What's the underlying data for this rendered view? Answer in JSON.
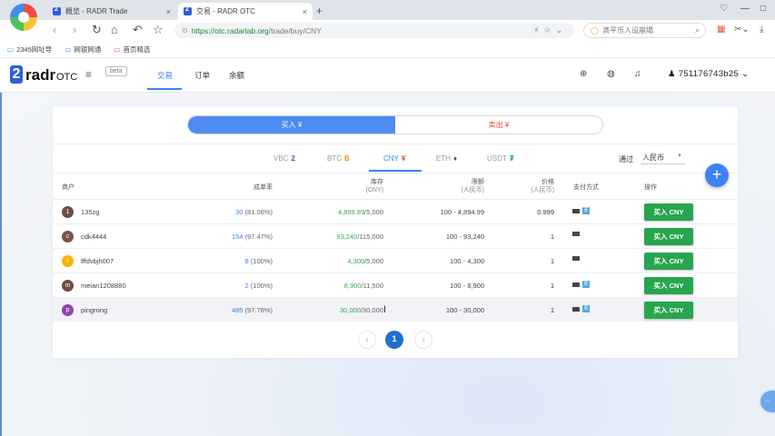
{
  "browser": {
    "tabs": [
      {
        "title": "概览 - RADR Trade",
        "close": "×"
      },
      {
        "title": "交易 - RADR OTC",
        "close": "×"
      }
    ],
    "new_tab": "+",
    "url_host": "https://otc.radarlab.org",
    "url_path": "/trade/buy/CNY",
    "search_placeholder": "滴平乐人设崩塌",
    "bookmarks": [
      "2345网址导",
      "网银网通",
      "首页精选"
    ]
  },
  "app": {
    "logo_mark": "2",
    "logo_text": "radr",
    "logo_sub": "OTC",
    "beta_badge": "beta",
    "nav": [
      "交易",
      "订单",
      "余额"
    ],
    "username": "751176743b25"
  },
  "trade": {
    "toggle": {
      "buy": "买入 ¥",
      "sell": "卖出 ¥"
    },
    "currencies": [
      {
        "code": "VBC",
        "icon": "2"
      },
      {
        "code": "BTC",
        "icon": "B"
      },
      {
        "code": "CNY",
        "icon": "¥"
      },
      {
        "code": "ETH",
        "icon": "♦"
      },
      {
        "code": "USDT",
        "icon": "₮"
      }
    ],
    "via_label": "通过",
    "via_value": "人民币",
    "headers": {
      "merchant": "商户",
      "rate": "成单率",
      "stock": "库存",
      "stock_unit": "(CNY)",
      "limit": "限额",
      "limit_unit": "(人民币)",
      "price": "价格",
      "price_unit": "(人民币)",
      "payment": "支付方式",
      "action": "操作"
    },
    "rows": [
      {
        "initial": "1",
        "avatar_color": "#6d4c41",
        "name": "135zg",
        "rate_n": "30",
        "rate_p": "(81.08%)",
        "stock_avail": "4,899.89",
        "stock_total": "/5,000",
        "limit": "100 - 4,894.99",
        "price": "0.999",
        "alipay": true,
        "btn": "买入 CNY"
      },
      {
        "initial": "c",
        "avatar_color": "#795548",
        "name": "cdk4444",
        "rate_n": "154",
        "rate_p": "(97.47%)",
        "stock_avail": "93,240",
        "stock_total": "/115,000",
        "limit": "100 - 93,240",
        "price": "1",
        "alipay": false,
        "btn": "买入 CNY"
      },
      {
        "initial": "l",
        "avatar_color": "#f5b400",
        "name": "lffdvbjh007",
        "rate_n": "8",
        "rate_p": "(100%)",
        "stock_avail": "4,300",
        "stock_total": "/5,000",
        "limit": "100 - 4,300",
        "price": "1",
        "alipay": false,
        "btn": "买入 CNY"
      },
      {
        "initial": "m",
        "avatar_color": "#6d4c41",
        "name": "meian1208880",
        "rate_n": "2",
        "rate_p": "(100%)",
        "stock_avail": "8,900",
        "stock_total": "/11,500",
        "limit": "100 - 8,900",
        "price": "1",
        "alipay": true,
        "btn": "买入 CNY"
      },
      {
        "initial": "p",
        "avatar_color": "#8e44ad",
        "name": "pingrong",
        "rate_n": "485",
        "rate_p": "(97.78%)",
        "stock_avail": "30,000",
        "stock_total": "/30,000",
        "limit": "100 - 30,000",
        "price": "1",
        "alipay": true,
        "btn": "买入 CNY"
      }
    ],
    "pagination": {
      "prev": "‹",
      "current": "1",
      "next": "›"
    },
    "fab": "+"
  },
  "icons": {
    "alipay": "支"
  },
  "colors": {
    "accent": "#3b82f6",
    "buy_green": "#28a54f",
    "sell_red": "#e04a3b"
  }
}
